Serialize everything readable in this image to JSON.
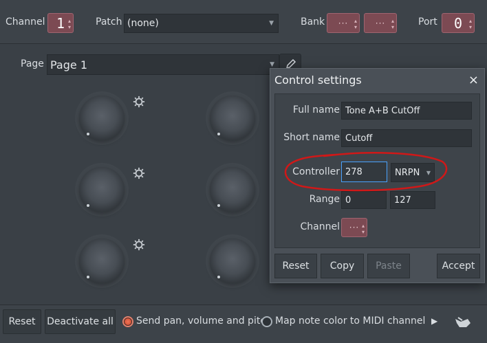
{
  "header": {
    "channel_label": "Channel",
    "channel_value": "1",
    "patch_label": "Patch",
    "patch_value": "(none)",
    "bank_label": "Bank",
    "bank_msb": "···",
    "bank_lsb": "···",
    "port_label": "Port",
    "port_value": "0"
  },
  "page_row": {
    "label": "Page",
    "value": "Page 1"
  },
  "knobs": {
    "count_visible": 6
  },
  "footer": {
    "reset_label": "Reset",
    "deactivate_label": "Deactivate all",
    "send_pan_label": "Send pan, volume and pitch",
    "send_pan_checked": true,
    "map_note_label": "Map note color to MIDI channel",
    "map_note_checked": false
  },
  "dialog": {
    "title": "Control settings",
    "close_glyph": "×",
    "full_name_label": "Full name",
    "full_name_value": "Tone A+B CutOff",
    "short_name_label": "Short name",
    "short_name_value": "Cutoff",
    "controller_label": "Controller",
    "controller_value": "278",
    "controller_type": "NRPN",
    "range_label": "Range",
    "range_min": "0",
    "range_max": "127",
    "channel_label": "Channel",
    "channel_value": "···",
    "buttons": {
      "reset": "Reset",
      "copy": "Copy",
      "paste": "Paste",
      "accept": "Accept"
    }
  },
  "colors": {
    "accent_red": "#7c4a53",
    "annotation": "#d01818",
    "focus": "#4aa3ff"
  }
}
